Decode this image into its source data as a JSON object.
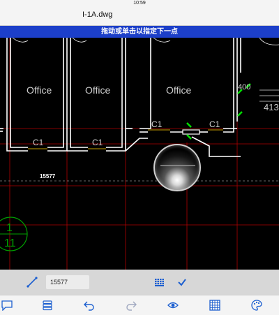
{
  "status": {
    "time": "10:59"
  },
  "header": {
    "file_name": "I-1A.dwg"
  },
  "prompt": {
    "hint": "拖动或单击以指定下一点"
  },
  "drawing": {
    "room_labels": [
      "Office",
      "Office",
      "Office"
    ],
    "door_labels": [
      "C1",
      "C1",
      "C1",
      "C1",
      "C1"
    ],
    "dimension_partial": "413",
    "dimension_partial_top": "400",
    "grid_bubble_top": "1",
    "grid_bubble_bottom": "11",
    "cursor_length_readout": "15577"
  },
  "input": {
    "length_value": "15577"
  },
  "toolbar": {
    "icons": [
      "comment-icon",
      "layers-icon",
      "undo-icon",
      "redo-icon",
      "view-icon",
      "grid-icon",
      "palette-icon"
    ]
  },
  "colors": {
    "accent": "#1c3fc9",
    "cad_line": "#ffffff",
    "grid_red": "#c00000",
    "snap_green": "#00e000",
    "door_yellow": "#c8a000"
  }
}
